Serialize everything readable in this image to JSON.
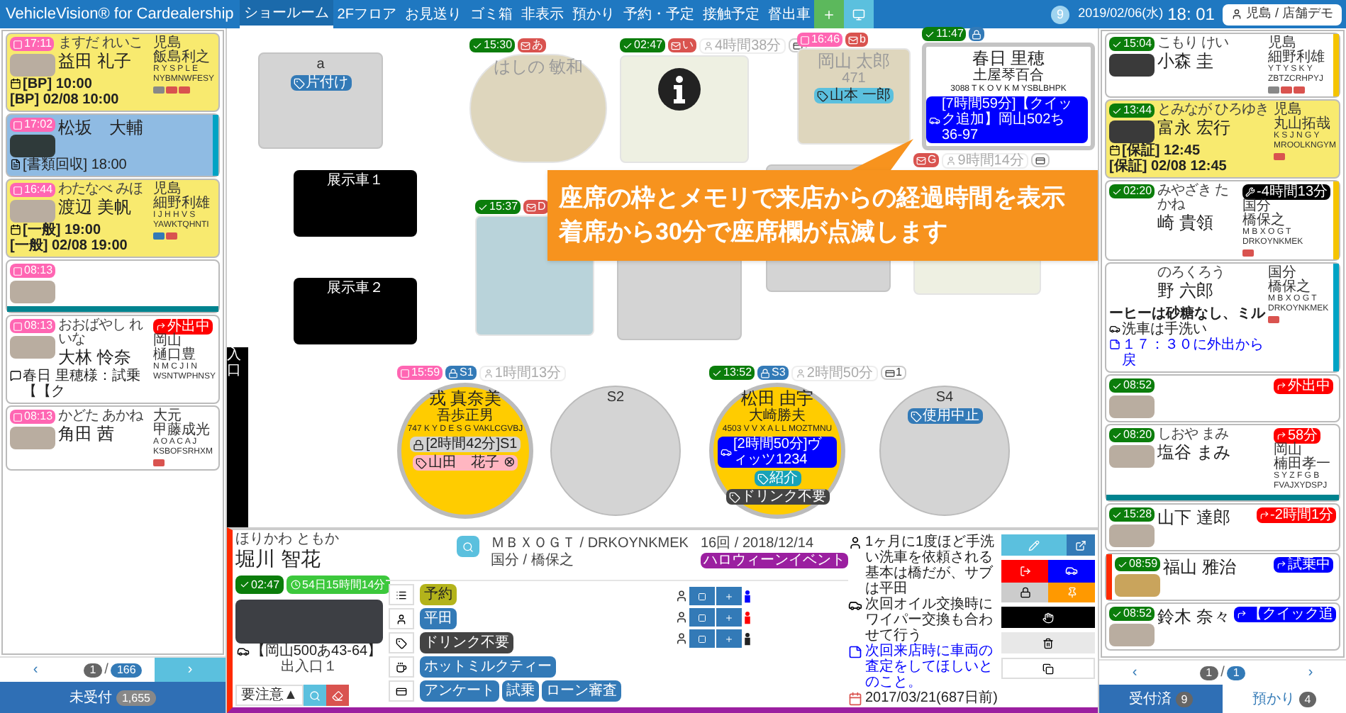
{
  "nav": {
    "brand": "VehicleVision® for Cardealership",
    "tabs": [
      {
        "label": "ショールーム",
        "selected": true
      },
      {
        "label": "2Fフロア",
        "selected": false
      },
      {
        "label": "お見送り",
        "selected": false
      },
      {
        "label": "ゴミ箱",
        "selected": false
      },
      {
        "label": "非表示",
        "selected": false
      },
      {
        "label": "預かり",
        "selected": false
      },
      {
        "label": "予約・予定",
        "selected": false
      },
      {
        "label": "接触予定",
        "selected": false
      },
      {
        "label": "督出車",
        "selected": false
      }
    ],
    "badge": "9",
    "date": "2019/02/06(水)",
    "time": "18: 01",
    "user": "児島 / 店舗デモ"
  },
  "left_panel": {
    "cards": [
      {
        "time": {
          "kind": "pending",
          "text": "17:11"
        },
        "photo": {
          "kind": "plate"
        },
        "color": "#f8ea6f",
        "kana": "ますだ れいこ",
        "name": "益田 礼子",
        "lines": [
          {
            "kind": "calendar",
            "text": "[BP] 10:00"
          },
          {
            "kind": "plain",
            "text": "[BP] 02/08 10:00"
          }
        ],
        "area": "児島",
        "staff": "飯島利之",
        "code1": "R Y S P L E",
        "code2": "NYBMNWFESY",
        "flags": [
          {
            "color": "#888888"
          },
          {
            "color": "#d9534f"
          },
          {
            "color": "#d9534f"
          }
        ]
      },
      {
        "time": {
          "kind": "pending",
          "text": "17:02"
        },
        "photo": {
          "kind": "dark_plate"
        },
        "color": "#8fbbe3",
        "accent": {
          "kind": "right",
          "color": "#00a3c4"
        },
        "name": "松坂　大輔",
        "lines": [
          {
            "kind": "document",
            "text": "[書類回収] 18:00"
          }
        ]
      },
      {
        "time": {
          "kind": "pending",
          "text": "16:44"
        },
        "photo": {
          "kind": "plate"
        },
        "color": "#f8ea6f",
        "kana": "わたなべ みほ",
        "name": "渡辺 美帆",
        "lines": [
          {
            "kind": "calendar",
            "text": "[一般] 19:00"
          },
          {
            "kind": "plain",
            "text": "[一般] 02/08 19:00"
          }
        ],
        "area": "児島",
        "staff": "細野利雄",
        "code1": "I J H H V S",
        "code2": "YAWKTQHNTI",
        "flags": [
          {
            "color": "#337ab7"
          },
          {
            "color": "#d9534f"
          }
        ]
      },
      {
        "time": {
          "kind": "pending",
          "text": "08:13"
        },
        "photo": {
          "kind": "plate"
        },
        "color": "#ffffff",
        "accent": {
          "kind": "bottom",
          "color": "#00838f"
        }
      },
      {
        "time": {
          "kind": "pending",
          "text": "08:13"
        },
        "photo": {
          "kind": "plate"
        },
        "color": "#ffffff",
        "kana": "おおばやし れいな",
        "name": "大林 怜奈",
        "lines": [
          {
            "kind": "bubble",
            "text": "春日 里穂様：試乗【【ク"
          }
        ],
        "status": {
          "kind": "out",
          "text": "外出中",
          "color": "#ff0000"
        },
        "area": "岡山",
        "staff": "樋口豊",
        "code1": "N M C J I N",
        "code2": "WSNTWPHNSY"
      },
      {
        "time": {
          "kind": "pending",
          "text": "08:13"
        },
        "photo": {
          "kind": "plate"
        },
        "color": "#ffffff",
        "kana": "かどた あかね",
        "name": "角田 茜",
        "area": "大元",
        "staff": "甲藤成光",
        "code1": "A O A C A J",
        "code2": "KSBOFSRHXM",
        "flags": [
          {
            "color": "#d9534f"
          }
        ]
      }
    ],
    "pager": {
      "prev": "‹",
      "page": "1",
      "sep": "/",
      "total": "166",
      "next": "›"
    },
    "footer": {
      "label": "未受付",
      "count": "1,655"
    }
  },
  "floor": {
    "seats": [
      {
        "kind": "box",
        "color": "#d4d4d4",
        "label": "a",
        "tags": [
          {
            "kind": "tag",
            "text": "片付け",
            "color": "#337ab7"
          }
        ]
      },
      {
        "kind": "round",
        "color": "#ded6bd",
        "faded": true,
        "badges": [
          {
            "kind": "checked",
            "text": "15:30"
          },
          {
            "kind": "mail",
            "text": "あ"
          }
        ],
        "name": "はしの 敏和"
      },
      {
        "kind": "box",
        "color": "#eef0e2",
        "faded": true,
        "info": true,
        "badges": [
          {
            "kind": "checked",
            "text": "02:47"
          },
          {
            "kind": "mail",
            "text": "い"
          },
          {
            "kind": "elapsed",
            "text": "4時間38分"
          },
          {
            "kind": "card"
          }
        ]
      },
      {
        "kind": "box",
        "color": "#ded6bd",
        "faded": true,
        "badges": [
          {
            "kind": "pending",
            "text": "16:46"
          },
          {
            "kind": "mail",
            "text": "b"
          }
        ],
        "name": "岡山 太郎",
        "sub": "471",
        "tags": [
          {
            "kind": "tag",
            "text": "山本 一郎",
            "color": "#5bc0de"
          }
        ]
      },
      {
        "kind": "box",
        "color": "#ffffff",
        "highlight": true,
        "badges": [
          {
            "kind": "checked",
            "text": "11:47"
          },
          {
            "kind": "lock"
          }
        ],
        "name": "春日 里穂",
        "sub": "土屋琴百合",
        "code": "3088 T K O V K M YSBLBHPK",
        "tags": [
          {
            "kind": "car",
            "text": "[7時間59分]【クイック追加】岡山502ち36-97",
            "color": "#0000ff"
          }
        ]
      },
      {
        "kind": "display",
        "label": "展示車１"
      },
      {
        "kind": "display",
        "label": "展示車２"
      },
      {
        "kind": "box",
        "color": "#b9d3da",
        "faded": true,
        "badges": [
          {
            "kind": "checked",
            "text": "15:37"
          },
          {
            "kind": "mail",
            "text": "D"
          }
        ]
      },
      {
        "kind": "box",
        "color": "#d4d4d4"
      },
      {
        "kind": "box",
        "color": "#d4d4d4"
      },
      {
        "kind": "box",
        "color": "#eef0e2",
        "faded": true,
        "badges": [
          {
            "kind": "mail",
            "text": "G"
          },
          {
            "kind": "elapsed",
            "text": "9時間14分"
          },
          {
            "kind": "card"
          }
        ]
      },
      {
        "kind": "round",
        "color": "#ffcc00",
        "highlight": true,
        "badges": [
          {
            "kind": "pending",
            "text": "15:59"
          },
          {
            "kind": "lock",
            "text": "S1"
          },
          {
            "kind": "elapsed",
            "text": "1時間13分"
          }
        ],
        "name": "戎 真奈美",
        "sub": "吾歩正男",
        "code": "747 K Y D E S G VAKLCGVBJ",
        "tags": [
          {
            "kind": "lock",
            "text": "[2時間42分]S1",
            "color": "#d3d3d3"
          },
          {
            "kind": "tag",
            "text": "山田　花子 ⊗",
            "color": "#ffb6c1"
          }
        ]
      },
      {
        "kind": "round",
        "color": "#d4d4d4",
        "label": "S2"
      },
      {
        "kind": "round",
        "color": "#ffcc00",
        "highlight": true,
        "badges": [
          {
            "kind": "checked",
            "text": "13:52"
          },
          {
            "kind": "lock",
            "text": "S3"
          },
          {
            "kind": "elapsed",
            "text": "2時間50分"
          },
          {
            "kind": "card",
            "text": "1"
          }
        ],
        "name": "松田 由宇",
        "sub": "大崎勝夫",
        "code": "4503 V V X A L L MOZTMNU",
        "tags": [
          {
            "kind": "car",
            "text": "[2時間50分]ヴィッツ1234",
            "color": "#0000ff"
          },
          {
            "kind": "tag",
            "text": "紹介",
            "color": "#17a2b8"
          },
          {
            "kind": "tag",
            "text": "ドリンク不要",
            "color": "#444444"
          }
        ]
      },
      {
        "kind": "round",
        "color": "#d4d4d4",
        "label": "S4",
        "tags": [
          {
            "kind": "tag",
            "text": "使用中止",
            "color": "#337ab7"
          }
        ]
      }
    ],
    "entrance": "入口",
    "callout": [
      "座席の枠とメモリで来店からの経過時間を表示",
      "着席から30分で座席欄が点滅します"
    ]
  },
  "detail": {
    "kana": "ほりかわ ともか",
    "name": "堀川 智花",
    "badges": [
      {
        "kind": "checked",
        "text": "02:47"
      },
      {
        "kind": "duration",
        "text": "54日15時間14分"
      }
    ],
    "plate": "【岡山500あ43-64】",
    "gate": "出入口１",
    "caution": "要注意▲",
    "vehicle_code": "ＭＢＸＯＧＴ / DRKOYNKMEK",
    "vehicle_staff": "国分 / 橋保之",
    "visits": "16回 / 2018/12/14",
    "event": "ハロウィーンイベント",
    "tag_rows": [
      {
        "tags": [
          {
            "text": "予約",
            "color": "#b3b31b"
          }
        ]
      },
      {
        "tags": [
          {
            "text": "平田",
            "color": "#337ab7"
          }
        ]
      },
      {
        "tags": [
          {
            "text": "ドリンク不要",
            "color": "#444444"
          }
        ]
      },
      {
        "tags": [
          {
            "text": "ホットミルクティー",
            "color": "#337ab7"
          }
        ]
      },
      {
        "tags": [
          {
            "text": "アンケート",
            "color": "#337ab7"
          },
          {
            "text": "試乗",
            "color": "#337ab7"
          },
          {
            "text": "ローン審査",
            "color": "#337ab7"
          }
        ]
      }
    ],
    "people": [
      {
        "color": "#0000ff"
      },
      {
        "color": "#ff0000"
      },
      {
        "color": "#222222"
      }
    ],
    "notes": [
      {
        "kind": "person",
        "text": "1ヶ月に1度ほど手洗い洗車を依頼される"
      },
      {
        "kind": "plain",
        "text": "基本は橋だが、サブは平田"
      },
      {
        "kind": "car",
        "text": "次回オイル交換時にワイパー交換も合わせて行う"
      },
      {
        "kind": "alert",
        "text": "次回来店時に車両の査定をしてほしいとのこと。"
      },
      {
        "kind": "date",
        "text": "2017/03/21(687日前)"
      }
    ]
  },
  "right_panel": {
    "cards": [
      {
        "time": {
          "kind": "checked",
          "text": "15:04"
        },
        "photo": {
          "kind": "no_image"
        },
        "color": "#ffffff",
        "accent": {
          "kind": "right",
          "color": "#f5c400"
        },
        "kana": "こもり けい",
        "name": "小森 圭",
        "area": "児島",
        "staff": "細野利雄",
        "code1": "Y T Y S K Y",
        "code2": "ZBTZCRHPYJ",
        "flags": [
          {
            "color": "#888888"
          },
          {
            "color": "#d9534f"
          },
          {
            "color": "#d9534f"
          }
        ]
      },
      {
        "time": {
          "kind": "checked",
          "text": "13:44"
        },
        "photo": {
          "kind": "no_image"
        },
        "color": "#f8ea6f",
        "kana": "とみなが ひろゆき",
        "name": "富永 宏行",
        "lines": [
          {
            "kind": "calendar",
            "text": "[保証] 12:45"
          },
          {
            "kind": "plain",
            "text": "[保証] 02/08 12:45"
          }
        ],
        "area": "児島",
        "staff": "丸山拓哉",
        "code1": "K S J N G Y",
        "code2": "MROOLKNGYM",
        "flags": [
          {
            "color": "#d9534f"
          }
        ]
      },
      {
        "time": {
          "kind": "checked",
          "text": "02:20"
        },
        "color": "#ffffff",
        "accent": {
          "kind": "right",
          "color": "#f5c400"
        },
        "kana": "みやざき たかね",
        "name": "崎 貴領",
        "status": {
          "kind": "repair",
          "text": "-4時間13分",
          "color": "#000000"
        },
        "area": "国分",
        "staff": "橋保之",
        "code1": "M B X O G T",
        "code2": "DRKOYNKMEK",
        "flags": [
          {
            "color": "#d9534f"
          }
        ]
      },
      {
        "color": "#ffffff",
        "accent": {
          "kind": "right",
          "color": "#00a3c4"
        },
        "kana": "のろくろう",
        "name": "野 六郎",
        "lines": [
          {
            "kind": "plain",
            "text": "ーヒーは砂糖なし、ミル"
          },
          {
            "kind": "car",
            "text": "洗車は手洗い"
          },
          {
            "kind": "alert",
            "text": "１７：３０に外出から戻"
          }
        ],
        "area": "国分",
        "staff": "橋保之",
        "code1": "M B X O G T",
        "code2": "DRKOYNKMEK",
        "flags": [
          {
            "color": "#d9534f"
          }
        ]
      },
      {
        "time": {
          "kind": "checked",
          "text": "08:52"
        },
        "photo": {
          "kind": "plate"
        },
        "color": "#ffffff",
        "status": {
          "kind": "out",
          "text": "外出中",
          "color": "#ff0000"
        }
      },
      {
        "time": {
          "kind": "checked",
          "text": "08:20"
        },
        "photo": {
          "kind": "plate"
        },
        "color": "#ffffff",
        "accent": {
          "kind": "bottom",
          "color": "#00838f"
        },
        "kana": "しおや まみ",
        "name": "塩谷 まみ",
        "status": {
          "kind": "out",
          "text": "58分",
          "color": "#ff0000"
        },
        "area": "岡山",
        "staff": "楠田孝一",
        "code1": "S Y Z F G B",
        "code2": "FVAJXYDSPJ"
      },
      {
        "time": {
          "kind": "checked",
          "text": "15:28"
        },
        "photo": {
          "kind": "plate"
        },
        "color": "#ffffff",
        "name": "山下 達郎",
        "status": {
          "kind": "out",
          "text": "-2時間1分",
          "color": "#ff0000"
        }
      },
      {
        "time": {
          "kind": "checked",
          "text": "08:59"
        },
        "photo": {
          "kind": "yellow_plate"
        },
        "color": "#ffffff",
        "accent": {
          "kind": "left",
          "color": "#ff2a00"
        },
        "name": "福山 雅治",
        "status": {
          "kind": "out",
          "text": "試乗中",
          "color": "#0000ff"
        }
      },
      {
        "time": {
          "kind": "checked",
          "text": "08:52"
        },
        "photo": {
          "kind": "plate"
        },
        "color": "#ffffff",
        "name": "鈴木 奈々",
        "status": {
          "kind": "out",
          "text": "【クイック追",
          "color": "#0000ff"
        }
      }
    ],
    "pager": {
      "prev": "‹",
      "page": "1",
      "sep": "/",
      "total": "1",
      "next": "›"
    },
    "tabs": [
      {
        "label": "受付済",
        "count": "9",
        "selected": true
      },
      {
        "label": "預かり",
        "count": "4",
        "selected": false
      }
    ]
  }
}
